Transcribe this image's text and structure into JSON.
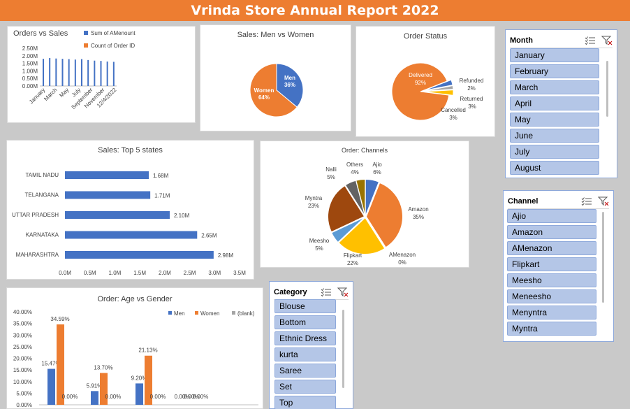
{
  "report": {
    "title": "Vrinda Store Annual Report 2022"
  },
  "colors": {
    "blue": "#4472c4",
    "orange": "#ed7d31",
    "grey": "#a5a5a5",
    "yellow": "#ffc000",
    "lightblue": "#5b9bd5",
    "green": "#70ad47",
    "darkblue": "#264478",
    "brown": "#9e480e",
    "darkgrey": "#636363",
    "olive": "#997300",
    "header": "#ed7d31",
    "slicer_fill": "#b4c6e7"
  },
  "orders_vs_sales": {
    "title": "Orders vs Sales",
    "legend": [
      "Sum of AMenount",
      "Count of Order ID"
    ],
    "y_ticks": [
      "2.50M",
      "2.00M",
      "1.50M",
      "1.00M",
      "0.50M",
      "0.00M"
    ],
    "x_ticks": [
      "January",
      "March",
      "May",
      "July",
      "September",
      "November",
      "12/4/2022"
    ]
  },
  "sales_men_women": {
    "title": "Sales: Men vs Women"
  },
  "order_status": {
    "title": "Order Status"
  },
  "top_states": {
    "title": "Sales: Top 5 states"
  },
  "channels": {
    "title": "Order: Channels"
  },
  "age_gender": {
    "title": "Order: Age vs Gender"
  },
  "slicers": {
    "month": {
      "title": "Month",
      "items": [
        "January",
        "February",
        "March",
        "April",
        "May",
        "June",
        "July",
        "August"
      ]
    },
    "channel": {
      "title": "Channel",
      "items": [
        "Ajio",
        "Amazon",
        "AMenazon",
        "Flipkart",
        "Meesho",
        "Meneesho",
        "Menyntra",
        "Myntra"
      ]
    },
    "category": {
      "title": "Category",
      "items": [
        "Blouse",
        "Bottom",
        "Ethnic Dress",
        "kurta",
        "Saree",
        "Set",
        "Top"
      ]
    }
  },
  "chart_data": [
    {
      "type": "bar",
      "title": "Orders vs Sales",
      "series": [
        {
          "name": "Sum of AMenount",
          "values": [
            1.8,
            1.85,
            1.82,
            1.8,
            1.78,
            1.75,
            1.78,
            1.72,
            1.68,
            1.66,
            1.62,
            1.6
          ]
        },
        {
          "name": "Count of Order ID",
          "values": [
            0.003,
            0.003,
            0.003,
            0.003,
            0.003,
            0.003,
            0.003,
            0.003,
            0.003,
            0.003,
            0.003,
            0.003
          ]
        }
      ],
      "ylim": [
        0,
        2.5
      ]
    },
    {
      "type": "pie",
      "title": "Sales: Men vs Women",
      "labels": [
        "Men",
        "Women"
      ],
      "values": [
        36,
        64
      ],
      "value_labels": [
        "36%",
        "64%"
      ]
    },
    {
      "type": "pie",
      "title": "Order Status",
      "labels": [
        "Delivered",
        "Refunded",
        "Returned",
        "Cancelled"
      ],
      "values": [
        92,
        2,
        3,
        3
      ],
      "value_labels": [
        "92%",
        "2%",
        "3%",
        "3%"
      ]
    },
    {
      "type": "bar",
      "title": "Sales: Top 5 states",
      "categories": [
        "TAMIL NADU",
        "TELANGANA",
        "UTTAR PRADESH",
        "KARNATAKA",
        "MAHARASHTRA"
      ],
      "values": [
        1.68,
        1.71,
        2.1,
        2.65,
        2.98
      ],
      "value_labels": [
        "1.68M",
        "1.71M",
        "2.10M",
        "2.65M",
        "2.98M"
      ],
      "x_ticks": [
        "0.0M",
        "0.5M",
        "1.0M",
        "1.5M",
        "2.0M",
        "2.5M",
        "3.0M",
        "3.5M"
      ],
      "xlim": [
        0,
        3.5
      ]
    },
    {
      "type": "pie",
      "title": "Order: Channels",
      "labels": [
        "Ajio",
        "Amazon",
        "AMenazon",
        "Flipkart",
        "Meesho",
        "Myntra",
        "Nalli",
        "Others"
      ],
      "values": [
        6,
        35,
        0,
        22,
        5,
        23,
        5,
        4
      ],
      "value_labels": [
        "6%",
        "35%",
        "0%",
        "22%",
        "5%",
        "23%",
        "5%",
        "4%"
      ]
    },
    {
      "type": "bar",
      "title": "Order: Age vs Gender",
      "legend": [
        "Men",
        "Women",
        "(blank)"
      ],
      "series": [
        {
          "name": "Men",
          "values": [
            15.47,
            5.91,
            9.2,
            0
          ]
        },
        {
          "name": "Women",
          "values": [
            34.59,
            13.7,
            21.13,
            0
          ]
        },
        {
          "name": "(blank)",
          "values": [
            0,
            0,
            0,
            0
          ]
        }
      ],
      "value_labels": {
        "Men": [
          "15.47%",
          "5.91%",
          "9.20%",
          "0.00%"
        ],
        "Women": [
          "34.59%",
          "13.70%",
          "21.13%",
          "0.00%"
        ],
        "(blank)": [
          "0.00%",
          "0.00%",
          "0.00%",
          "0.00%"
        ]
      },
      "y_ticks": [
        "40.00%",
        "35.00%",
        "30.00%",
        "25.00%",
        "20.00%",
        "15.00%",
        "10.00%",
        "5.00%",
        "0.00%"
      ],
      "ylim": [
        0,
        40
      ]
    }
  ]
}
